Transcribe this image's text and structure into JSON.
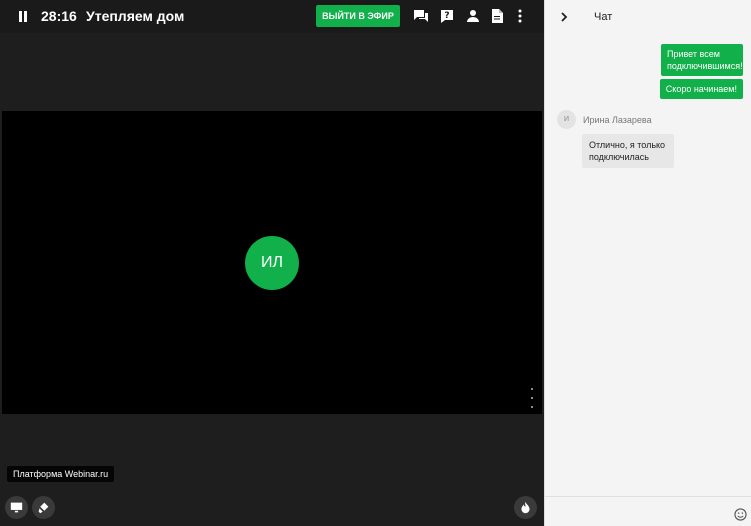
{
  "header": {
    "timer": "28:16",
    "title": "Утепляем дом",
    "live_button_label": "ВЫЙТИ В ЭФИР",
    "icons": [
      "pause-icon",
      "chat-icon",
      "question-icon",
      "person-icon",
      "document-icon",
      "more-vertical-icon"
    ]
  },
  "video": {
    "participant_initials": "ИЛ"
  },
  "footer": {
    "platform_label": "Платформа Webinar.ru",
    "icons": [
      "screen-share-icon",
      "brush-icon",
      "fire-icon"
    ]
  },
  "chat": {
    "title": "Чат",
    "messages_out": [
      "Привет всем подключившимся!",
      "Скоро начинаем!"
    ],
    "peer": {
      "initial": "И",
      "name": "Ирина Лазарева",
      "message": "Отлично, я только подключилась"
    }
  },
  "colors": {
    "accent": "#11b04a",
    "stage_bg": "#1e1e1e",
    "chat_bg": "#f4f4f4"
  }
}
